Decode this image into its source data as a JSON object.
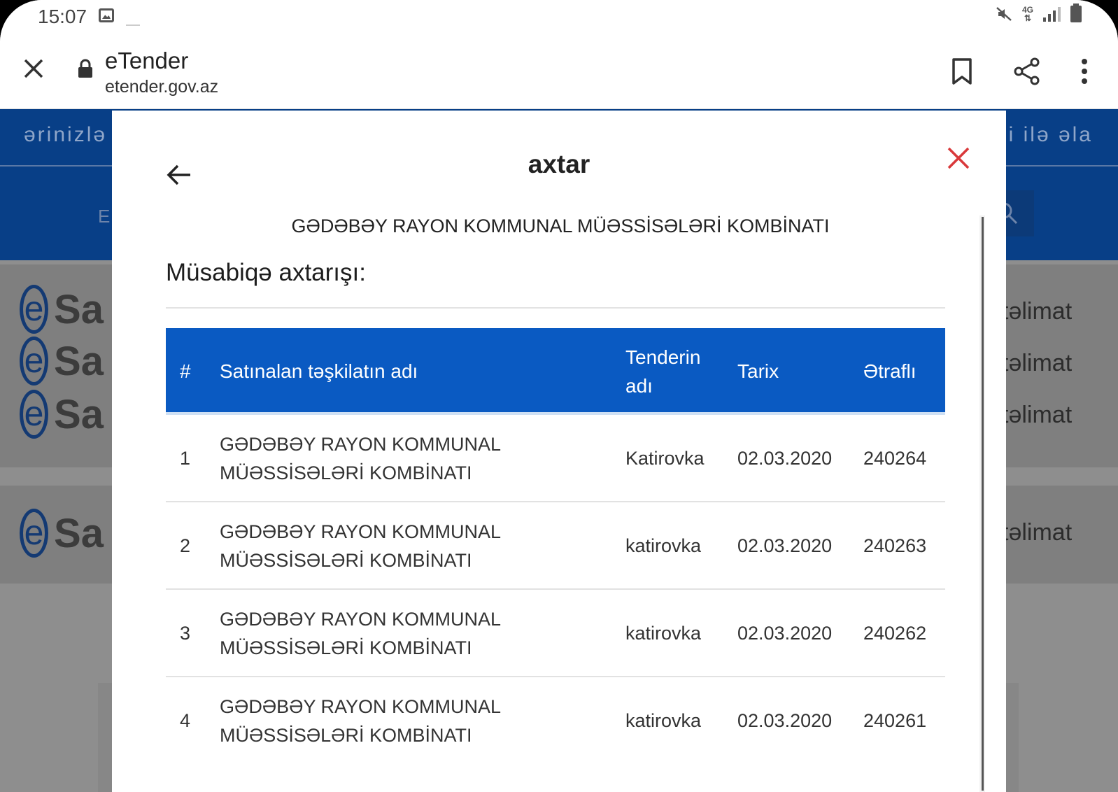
{
  "status_bar": {
    "time": "15:07",
    "network": "4G",
    "icons": [
      "gallery-icon",
      "mute-icon",
      "signal-icon",
      "battery-icon"
    ]
  },
  "browser": {
    "title": "eTender",
    "url": "etender.gov.az",
    "icons": [
      "close-icon",
      "lock-icon",
      "bookmark-icon",
      "share-icon",
      "more-vert-icon"
    ]
  },
  "background_page": {
    "nav_left": "ərinizlə",
    "nav_right": "i ilə əla",
    "search_left": "E",
    "card_text_right": [
      "təlimat",
      "təlimat",
      "təlimat",
      "təlimat"
    ]
  },
  "modal": {
    "title": "axtar",
    "organization": "GƏDƏBƏY RAYON KOMMUNAL MÜƏSSİSƏLƏRİ KOMBİNATI",
    "heading": "Müsabiqə axtarışı:",
    "table": {
      "headers": {
        "num": "#",
        "org_name": "Satınalan təşkilatın adı",
        "tender_name_line1": "Tenderin",
        "tender_name_line2": "adı",
        "date": "Tarix",
        "details": "Ətraflı"
      },
      "rows": [
        {
          "num": "1",
          "org_line1": "GƏDƏBƏY RAYON KOMMUNAL",
          "org_line2": "MÜƏSSİSƏLƏRİ KOMBİNATI",
          "tender": "Katirovka",
          "date": "02.03.2020",
          "details": "240264"
        },
        {
          "num": "2",
          "org_line1": "GƏDƏBƏY RAYON KOMMUNAL",
          "org_line2": "MÜƏSSİSƏLƏRİ KOMBİNATI",
          "tender": "katirovka",
          "date": "02.03.2020",
          "details": "240263"
        },
        {
          "num": "3",
          "org_line1": "GƏDƏBƏY RAYON KOMMUNAL",
          "org_line2": "MÜƏSSİSƏLƏRİ KOMBİNATI",
          "tender": "katirovka",
          "date": "02.03.2020",
          "details": "240262"
        },
        {
          "num": "4",
          "org_line1": "GƏDƏBƏY RAYON KOMMUNAL",
          "org_line2": "MÜƏSSİSƏLƏRİ KOMBİNATI",
          "tender": "katirovka",
          "date": "02.03.2020",
          "details": "240261"
        }
      ]
    }
  },
  "colors": {
    "header_blue": "#0a5ac2",
    "nav_blue": "#083f87",
    "close_red": "#d9383a"
  }
}
